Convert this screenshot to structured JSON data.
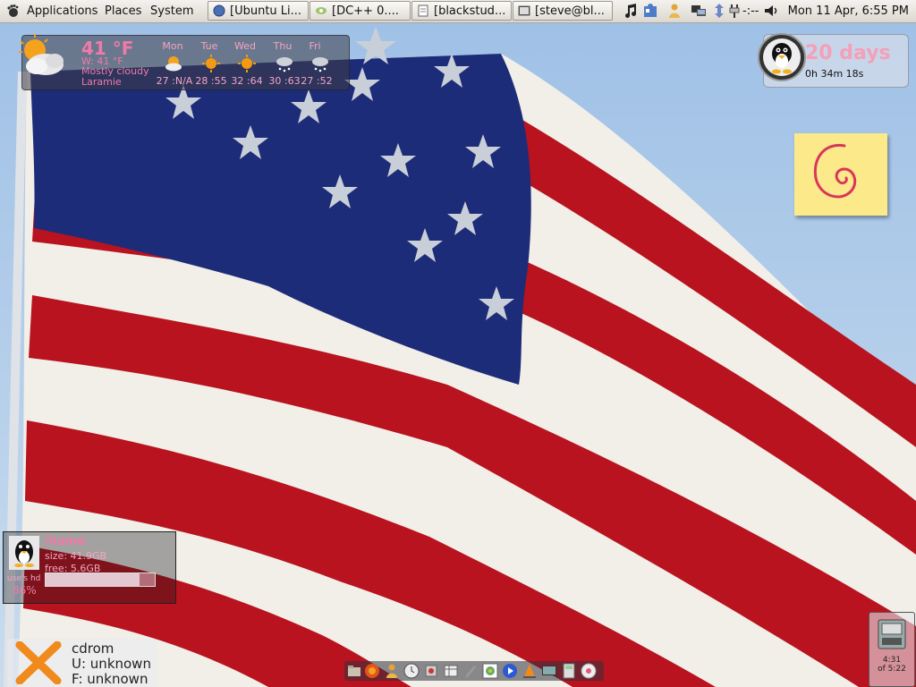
{
  "panel": {
    "menus": [
      "Applications",
      "Places",
      "System"
    ],
    "tasks": [
      "[Ubuntu Li...",
      "[DC++ 0....",
      "[blackstud...",
      "[steve@bl..."
    ],
    "net_speed": "-:--",
    "clock": "Mon 11 Apr,  6:55 PM"
  },
  "weather": {
    "current_temp": "41 °F",
    "windchill": "W: 41 °F",
    "condition": "Mostly cloudy",
    "location": "Laramie",
    "days": [
      {
        "name": "Mon",
        "temps": "27 :N/A",
        "icon": "sun-cloud-icon"
      },
      {
        "name": "Tue",
        "temps": "28 :55",
        "icon": "sun-icon"
      },
      {
        "name": "Wed",
        "temps": "32 :64",
        "icon": "sun-icon"
      },
      {
        "name": "Thu",
        "temps": "30 :63",
        "icon": "snow-cloud-icon"
      },
      {
        "name": "Fri",
        "temps": "27 :52",
        "icon": "snow-cloud-icon"
      }
    ]
  },
  "uptime": {
    "days": "20 days",
    "time": "0h 34m 18s"
  },
  "disk": {
    "mount": "/home",
    "size": "size: 41.9GB",
    "free": "free: 5.6GB",
    "label": "use's hd",
    "percent": "86%",
    "usage_fraction": 0.86
  },
  "cdrom": {
    "title": "cdrom",
    "used": "U: unknown",
    "free": "F: unknown"
  },
  "battery": {
    "time": "4:31",
    "of": "of 5:22"
  },
  "colors": {
    "accent_pink": "#f07aa8",
    "flag_red": "#b8131e",
    "flag_blue": "#1d2c78"
  }
}
